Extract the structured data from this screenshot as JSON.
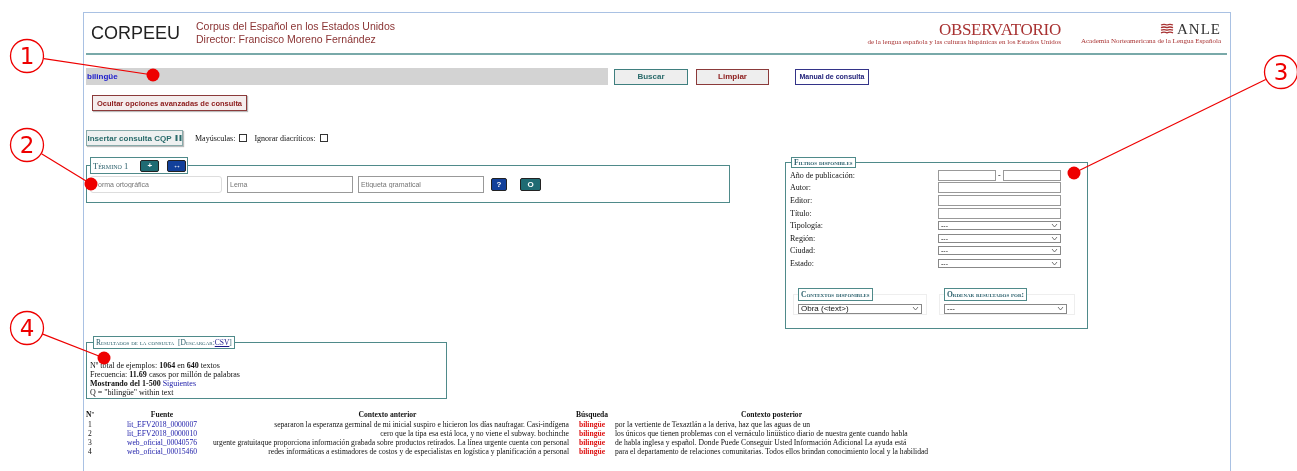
{
  "header": {
    "title": "CORPEEU",
    "subtitle": "Corpus del Español en los Estados Unidos",
    "director": "Director: Francisco Moreno Fernández",
    "logos": [
      {
        "name": "OBSERVATORIO",
        "tagline": "de la lengua española y las culturas hispánicas en los Estados Unidos"
      },
      {
        "name": "ANLE",
        "tagline": "Academia Norteamericana de la Lengua Española"
      }
    ]
  },
  "search": {
    "value": "bilingüe",
    "buttons": [
      {
        "label": "Buscar",
        "kind": "search"
      },
      {
        "label": "Limpiar",
        "kind": "clear"
      },
      {
        "label": "Manual de consulta",
        "kind": "manual"
      }
    ]
  },
  "advanced_toggle": "Ocultar opciones avanzadas de consulta",
  "cqp_button": "Insertar consulta CQP",
  "options": [
    {
      "label": "Mayúsculas:",
      "checked": false
    },
    {
      "label": "Ignorar diacríticos:",
      "checked": false
    }
  ],
  "term": {
    "legend": "Término 1",
    "add": "+",
    "swap": "↔",
    "fields": [
      {
        "placeholder": "orma ortográfica"
      },
      {
        "placeholder": "Lema"
      },
      {
        "placeholder": "Etiqueta gramatical"
      }
    ],
    "help": "?",
    "or": "O"
  },
  "filters": {
    "legend": "Filtros disponibles",
    "rows": [
      {
        "label": "Año de publicación:",
        "kind": "range",
        "separator": "-"
      },
      {
        "label": "Autor:",
        "kind": "text"
      },
      {
        "label": "Editor:",
        "kind": "text"
      },
      {
        "label": "Título:",
        "kind": "text"
      },
      {
        "label": "Tipología:",
        "kind": "select",
        "value": "---"
      },
      {
        "label": "Región:",
        "kind": "select",
        "value": "---"
      },
      {
        "label": "Ciudad:",
        "kind": "select",
        "value": "---"
      },
      {
        "label": "Estado:",
        "kind": "select",
        "value": "---"
      }
    ],
    "contexts": {
      "legend": "Contextos disponibles",
      "value": "Obra (<text>)"
    },
    "order": {
      "legend": "Ordenar resultados por:",
      "value": "---"
    }
  },
  "results": {
    "legend": "Resultados de la consulta",
    "download_open": "[Descargar:",
    "download_link": "CSV",
    "download_close": "]",
    "summary": [
      "Nº total de ejemplos: **1064** en **640** textos",
      "Frecuencia: **11.69** casos por millón de palabras"
    ],
    "showing": "Mostrando del 1-500",
    "next": "Siguientes",
    "query": "Q = \"bilingüe\" within text"
  },
  "table": {
    "columns": [
      "Nº",
      "Fuente",
      "Contexto anterior",
      "Búsqueda",
      "Contexto posterior"
    ],
    "rows": [
      {
        "number": "1",
        "source": "lit_EFV2018_0000007",
        "before": "separaron la esperanza germinal de mi inicial suspiro e hicieron los días naufragar. Casi-indígena",
        "match": "bilingüe",
        "after": "por la vertiente de Texaztlán a la deriva, haz que las aguas de un"
      },
      {
        "number": "2",
        "source": "lit_EFV2018_0000010",
        "before": "cero que la tipa esa está loca, y no viene el subway. bochinche",
        "match": "bilingüe",
        "after": "los únicos que tienen problemas con el vernáculo linüístico diario de nuestra gente cuando habla"
      },
      {
        "number": "3",
        "source": "web_oficial_00040576",
        "before": "urgente gratuitaque proporciona información grabada sobre productos retirados. La línea urgente cuenta con personal",
        "match": "bilingüe",
        "after": "de habla inglesa y español. Donde Puede Conseguir Usted Información Adicional La ayuda está"
      },
      {
        "number": "4",
        "source": "web_oficial_00015460",
        "before": "redes informáticas a estimadores de costos y de especialistas en logística y planificación a personal",
        "match": "bilingüe",
        "after": "para el departamento de relaciones comunitarias. Todos ellos brindan conocimiento local y la habilidad"
      }
    ]
  },
  "annotations": [
    {
      "number": "1"
    },
    {
      "number": "2"
    },
    {
      "number": "3"
    },
    {
      "number": "4"
    }
  ]
}
